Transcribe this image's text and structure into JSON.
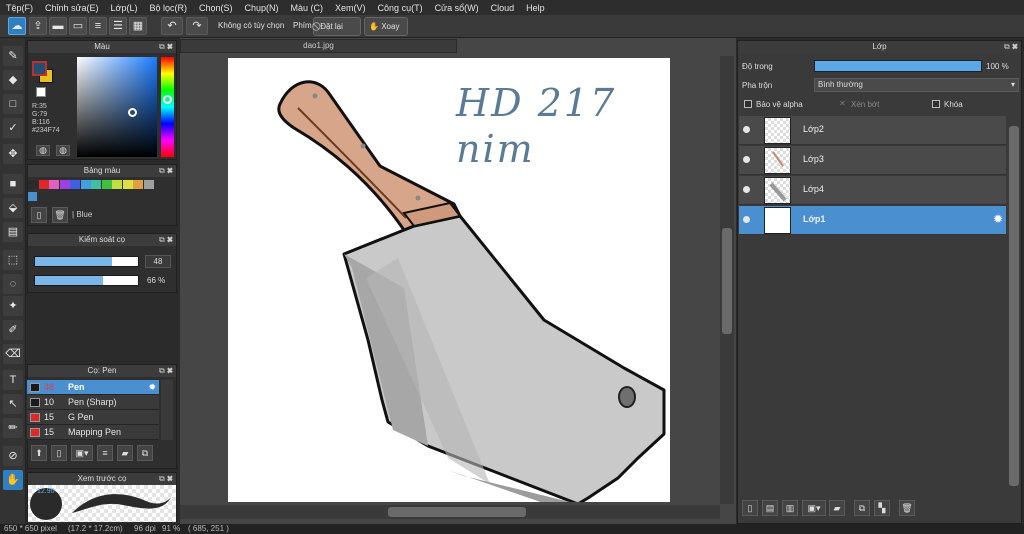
{
  "menu": [
    "Tệp(F)",
    "Chỉnh sửa(E)",
    "Lớp(L)",
    "Bộ lọc(R)",
    "Chọn(S)",
    "Chụp(N)",
    "Màu (C)",
    "Xem(V)",
    "Công cụ(T)",
    "Cửa sổ(W)",
    "Cloud",
    "Help"
  ],
  "toolbar": {
    "no_options": "Không có tùy chọn",
    "keys_label": "Phím",
    "reset_label": "Đặt lại",
    "rotate_label": "Xoay"
  },
  "color_panel": {
    "title": "Màu",
    "r": "R:35",
    "g": "G:79",
    "b": "B:116",
    "hex": "#234F74",
    "fg_color": "#234F74",
    "bg_color": "#E8C020"
  },
  "palette_panel": {
    "title": "Bảng màu",
    "palette_name": "Blue",
    "swatches": [
      "#2a2a2a",
      "#e02828",
      "#e060c0",
      "#a040e0",
      "#4060e0",
      "#40a0e0",
      "#40c0a0",
      "#40c040",
      "#c0e040",
      "#e0e040",
      "#e0a040",
      "#a0a0a0"
    ]
  },
  "brush_control": {
    "title": "Kiểm soát cọ",
    "size_value": "48",
    "size_fill": 0.75,
    "opacity_value": "66 %",
    "opacity_fill": 0.66
  },
  "brush_panel": {
    "title": "Cọ: Pen",
    "brushes": [
      {
        "size": "48",
        "name": "Pen",
        "color": "#1a1a1a"
      },
      {
        "size": "10",
        "name": "Pen (Sharp)",
        "color": "#1a1a1a"
      },
      {
        "size": "15",
        "name": "G Pen",
        "color": "#e02828"
      },
      {
        "size": "15",
        "name": "Mapping Pen",
        "color": "#e02828"
      }
    ]
  },
  "brush_preview": {
    "title": "Xem trước cọ",
    "size_label": "12.90"
  },
  "document": {
    "tab_title": "dao1.jpg",
    "handwriting": "HD 217 nim"
  },
  "layers_panel": {
    "title": "Lớp",
    "opacity_label": "Độ trong",
    "opacity_value": "100 %",
    "opacity_fill": 1.0,
    "blend_label": "Pha trộn",
    "blend_value": "Bình thường",
    "protect_alpha": "Bảo vệ alpha",
    "clipping": "Xén bớt",
    "lock": "Khóa",
    "layers": [
      {
        "name": "Lớp2",
        "selected": false
      },
      {
        "name": "Lớp3",
        "selected": false
      },
      {
        "name": "Lớp4",
        "selected": false
      },
      {
        "name": "Lớp1",
        "selected": true
      }
    ]
  },
  "status": {
    "size": "650 * 650 pixel",
    "cm": "(17.2 * 17.2cm)",
    "dpi": "96 dpi",
    "zoom": "91 %",
    "coords": "( 685, 251 )"
  }
}
